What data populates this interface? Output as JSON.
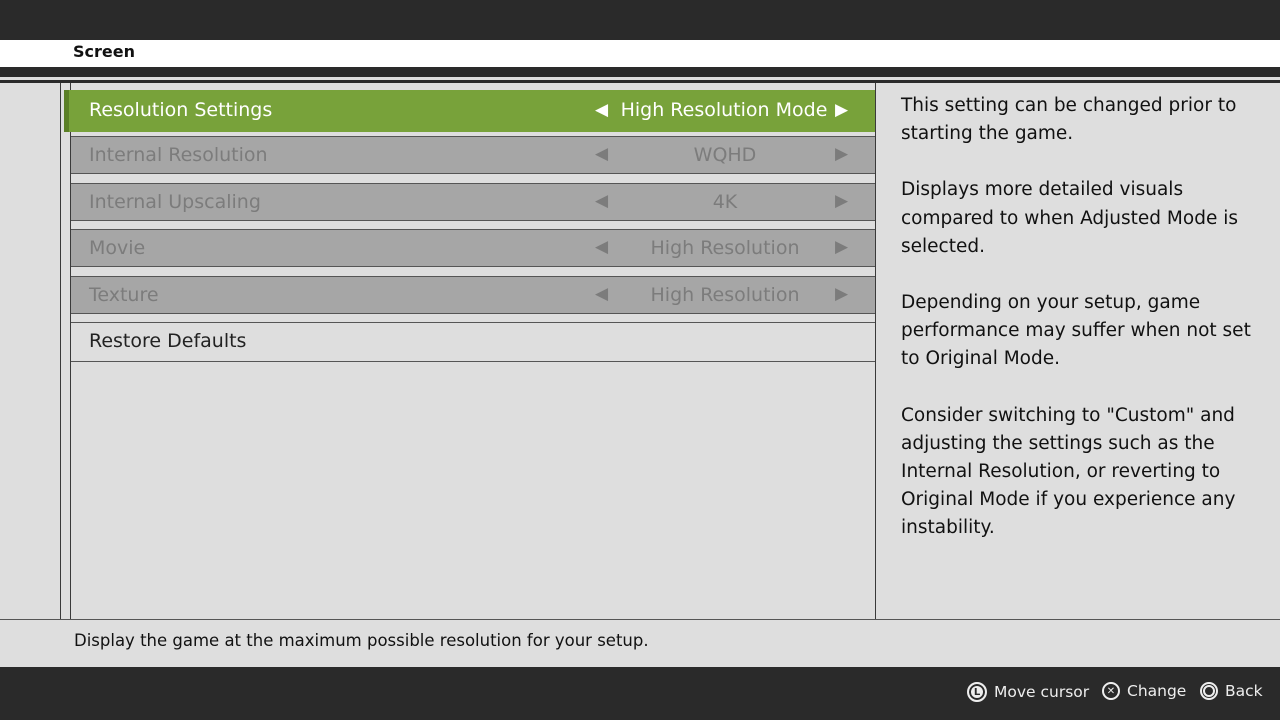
{
  "header": {
    "title": "Screen"
  },
  "settings": [
    {
      "label": "Resolution Settings",
      "value": "High Resolution Mode",
      "state": "selected"
    },
    {
      "label": "Internal Resolution",
      "value": "WQHD",
      "state": "disabled"
    },
    {
      "label": "Internal Upscaling",
      "value": "4K",
      "state": "disabled"
    },
    {
      "label": "Movie",
      "value": "High Resolution",
      "state": "disabled"
    },
    {
      "label": "Texture",
      "value": "High Resolution",
      "state": "disabled"
    },
    {
      "label": "Restore Defaults",
      "value": "",
      "state": "normal"
    }
  ],
  "arrows": {
    "left": "◀",
    "right": "▶"
  },
  "description": {
    "paragraphs": [
      "This setting can be changed prior to starting the game.",
      "Displays more detailed visuals compared to when Adjusted Mode is selected.",
      "Depending on your setup, game performance may suffer when not set to Original Mode.",
      "Consider switching to \"Custom\" and adjusting the settings such as the Internal Resolution, or reverting to Original Mode if you experience any instability."
    ]
  },
  "help_text": "Display the game at the maximum possible resolution for your setup.",
  "controls": [
    {
      "icon": "left-stick-icon",
      "glyph": "L",
      "label": "Move cursor"
    },
    {
      "icon": "cross-button-icon",
      "glyph": "✕",
      "label": "Change"
    },
    {
      "icon": "circle-button-icon",
      "glyph": "",
      "label": "Back"
    }
  ],
  "colors": {
    "accent": "#78a23a",
    "disabled_row": "#a6a6a6",
    "bar": "#2a2a2a",
    "background": "#dedede"
  }
}
